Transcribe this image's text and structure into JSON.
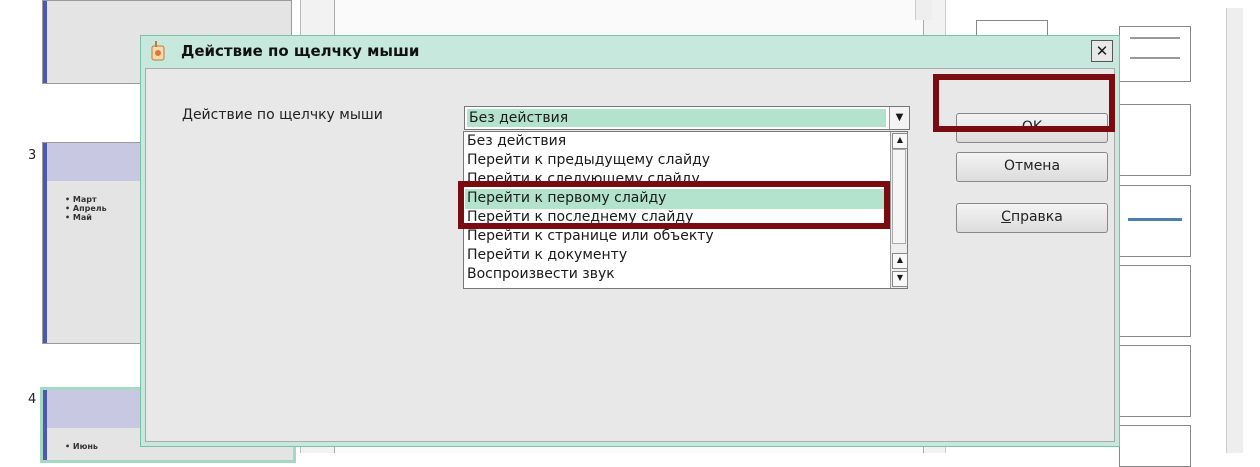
{
  "slides": [
    {
      "number": "3",
      "bullets": "• Март\n• Апрель\n• Май"
    },
    {
      "number": "4",
      "bullets": "• Июнь"
    }
  ],
  "dialog": {
    "title": "Действие по щелчку мыши",
    "field_label": "Действие по щелчку мыши",
    "selected_value": "Без действия",
    "options": [
      "Без действия",
      "Перейти к предыдущему слайду",
      "Перейти к следующему слайду",
      "Перейти к первому слайду",
      "Перейти к последнему слайду",
      "Перейти к странице или объекту",
      "Перейти к документу",
      "Воспроизвести звук"
    ],
    "highlighted_option_index": 3,
    "ok_label": "OK",
    "cancel_label": "Отмена",
    "help_label_underlined": "С",
    "help_label_rest": "правка",
    "close_label": "✕"
  },
  "colors": {
    "dialog_bg": "#c7e8dc",
    "selection": "#b3e3cc",
    "highlight_frame": "#7a0b10"
  },
  "icons": [
    "dialog-app-icon",
    "close-icon",
    "dropdown-arrow-icon",
    "scroll-up-icon",
    "scroll-down-icon"
  ]
}
